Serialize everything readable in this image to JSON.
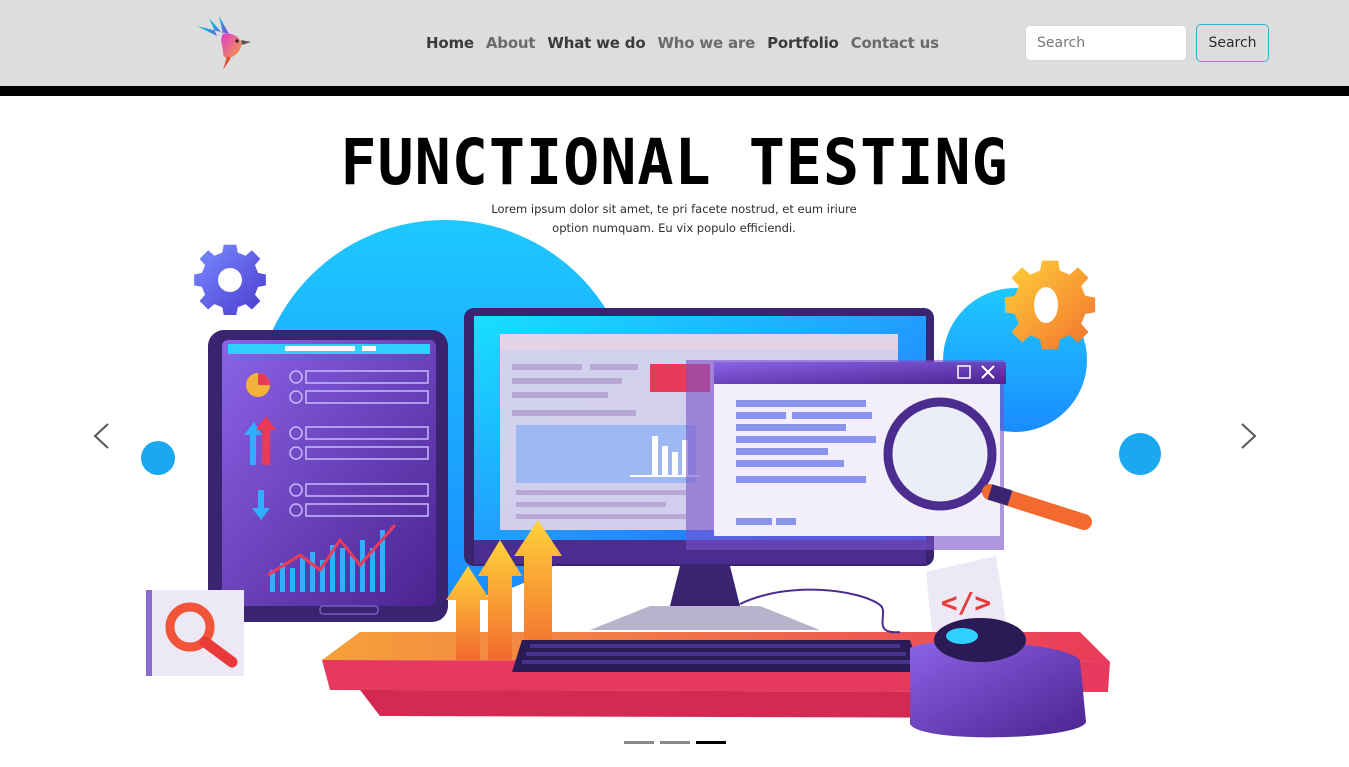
{
  "nav": {
    "logo_icon": "hummingbird-logo-icon",
    "links": [
      {
        "label": "Home",
        "style": "dark"
      },
      {
        "label": "About",
        "style": "muted"
      },
      {
        "label": "What we do",
        "style": "dark"
      },
      {
        "label": "Who we are",
        "style": "muted"
      },
      {
        "label": "Portfolio",
        "style": "dark"
      },
      {
        "label": "Contact us",
        "style": "muted"
      }
    ],
    "search_placeholder": "Search",
    "search_button": "Search"
  },
  "carousel": {
    "slide": {
      "title": "FUNCTIONAL TESTING",
      "caption_line1": "Lorem ipsum dolor sit amet, te pri facete nostrud, et eum iriure",
      "caption_line2": "option numquam. Eu vix populo efficiendi."
    },
    "prev_icon": "chevron-left-icon",
    "next_icon": "chevron-right-icon",
    "slide_count": 3,
    "active_index": 2
  },
  "colors": {
    "navbar_bg": "#dddddd",
    "accent_border": "#2fb3d6",
    "cyan": "#1fb6f2",
    "purple": "#6a3bbf",
    "orange": "#f26a2e"
  }
}
